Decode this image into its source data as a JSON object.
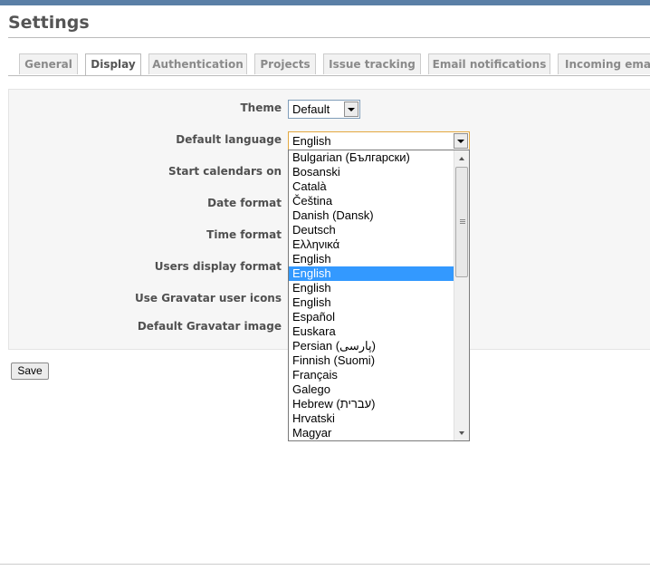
{
  "page": {
    "title": "Settings"
  },
  "tabs": [
    {
      "label": "General",
      "selected": false
    },
    {
      "label": "Display",
      "selected": true
    },
    {
      "label": "Authentication",
      "selected": false
    },
    {
      "label": "Projects",
      "selected": false
    },
    {
      "label": "Issue tracking",
      "selected": false
    },
    {
      "label": "Email notifications",
      "selected": false
    },
    {
      "label": "Incoming emai",
      "selected": false
    }
  ],
  "form": {
    "theme": {
      "label": "Theme",
      "value": "Default"
    },
    "default_language": {
      "label": "Default language",
      "value": "English",
      "options": [
        "Bulgarian (Български)",
        "Bosanski",
        "Català",
        "Čeština",
        "Danish (Dansk)",
        "Deutsch",
        "Ελληνικά",
        "English",
        "English",
        "English",
        "English",
        "Español",
        "Euskara",
        "Persian (پارسی)",
        "Finnish (Suomi)",
        "Français",
        "Galego",
        "Hebrew (עברית)",
        "Hrvatski",
        "Magyar"
      ],
      "highlighted_index": 8
    },
    "start_calendars_on": {
      "label": "Start calendars on"
    },
    "date_format": {
      "label": "Date format"
    },
    "time_format": {
      "label": "Time format"
    },
    "users_display_format": {
      "label": "Users display format"
    },
    "use_gravatar": {
      "label": "Use Gravatar user icons"
    },
    "default_gravatar_image": {
      "label": "Default Gravatar image"
    }
  },
  "actions": {
    "save_label": "Save"
  },
  "colors": {
    "accent": "#5a7fa6",
    "highlight": "#3399ff",
    "focus_border": "#e3a840"
  }
}
